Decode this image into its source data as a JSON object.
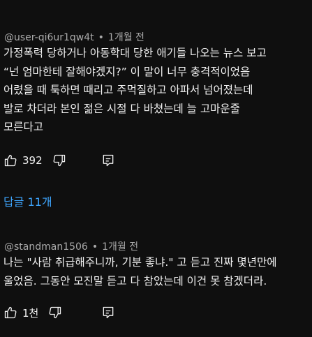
{
  "comments": [
    {
      "author": "@user-qi6ur1qw4t",
      "separator": "•",
      "time": "1개월 전",
      "lines": [
        "가정폭력 당하거나 아동학대 당한 애기들 나오는 뉴스 보고",
        "“넌 엄마한테 잘해야겠지?” 이 말이 너무 충격적이었음",
        "어렸을 때 툭하면 때리고 주먹질하고 아파서 넘어졌는데",
        "발로 차더라 본인 젊은 시절 다 바쳤는데 늘 고마운줄",
        "모른다고"
      ],
      "likes": "392",
      "replies_link": "답글 11개"
    },
    {
      "author": "@standman1506",
      "separator": "•",
      "time": "1개월 전",
      "lines": [
        "나는 \"사람 취급해주니까, 기분 좋냐.\" 고 듣고 진짜 몇년만에",
        "울었음. 그동안 모진말 듣고 다 참았는데 이건 못 참겠더라."
      ],
      "likes": "1천"
    }
  ],
  "icons": {
    "like": "thumbs-up-icon",
    "dislike": "thumbs-down-icon",
    "reply": "comment-reply-icon"
  },
  "colors": {
    "background": "#0f0f0f",
    "text": "#f1f1f1",
    "meta": "#aaaaaa",
    "link": "#3ea6ff"
  }
}
